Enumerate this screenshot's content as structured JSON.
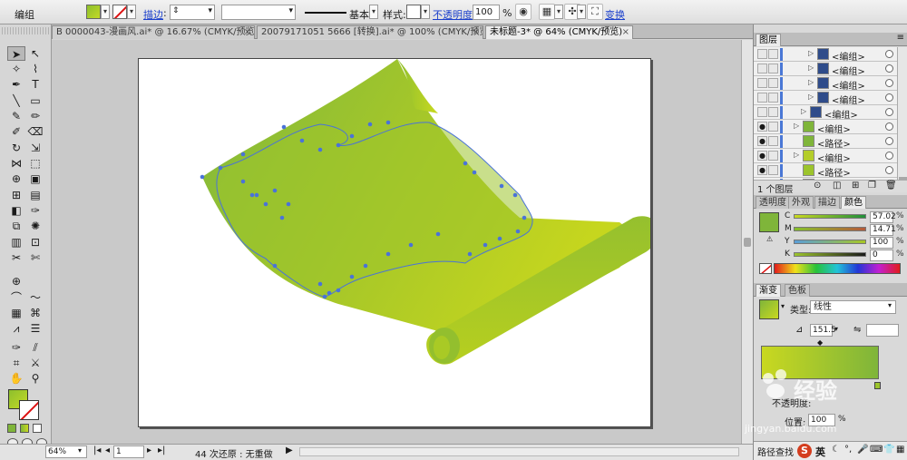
{
  "control_bar": {
    "selection_label": "编组",
    "stroke_link": "描边",
    "stroke_profile_label": "基本",
    "style_label": "样式:",
    "opacity_link": "不透明度:",
    "opacity_value": "100",
    "opacity_unit": "%",
    "transform_link": "变换"
  },
  "tabs": [
    {
      "label": "B 0000043-漫画风.ai* @ 16.67% (CMYK/预览)",
      "active": false
    },
    {
      "label": "20079171051 5666 [转换].ai* @ 100% (CMYK/预览)",
      "active": false
    },
    {
      "label": "未标题-3* @ 64% (CMYK/预览)",
      "active": true
    }
  ],
  "tab_close_glyph": "×",
  "status_bar": {
    "zoom": "64%",
    "artboard_number": "1",
    "history_text": "44 次还原 : 无重做"
  },
  "layers_panel": {
    "title": "图层",
    "rows": [
      {
        "name": "<编组>",
        "indent": 3
      },
      {
        "name": "<编组>",
        "indent": 3
      },
      {
        "name": "<编组>",
        "indent": 3
      },
      {
        "name": "<编组>",
        "indent": 3
      },
      {
        "name": "<编组>",
        "indent": 2
      },
      {
        "name": "<编组>",
        "indent": 1
      },
      {
        "name": "<路径>",
        "indent": 1
      },
      {
        "name": "<编组>",
        "indent": 1
      },
      {
        "name": "<路径>",
        "indent": 1
      },
      {
        "name": "<路径>",
        "indent": 1
      }
    ],
    "footer_count": "1 个图层"
  },
  "color_panel": {
    "tabs": [
      "透明度",
      "外观",
      "描边",
      "颜色"
    ],
    "active_tab": "颜色",
    "channels": [
      {
        "label": "C",
        "value": "57.02",
        "unit": "%"
      },
      {
        "label": "M",
        "value": "14.71",
        "unit": "%"
      },
      {
        "label": "Y",
        "value": "100",
        "unit": "%"
      },
      {
        "label": "K",
        "value": "0",
        "unit": "%"
      }
    ],
    "fill_color": "#7fb53a"
  },
  "gradient_panel": {
    "tabs": [
      "渐变",
      "色板"
    ],
    "active_tab": "渐变",
    "type_label": "类型:",
    "type_value": "线性",
    "angle_value": "151.5",
    "opacity_label": "不透明度:",
    "location_label": "位置:",
    "location_value": "100",
    "location_unit": "%",
    "gradient_start": "#7fb53a",
    "gradient_end": "#c9d820"
  },
  "bottom_panel": {
    "label": "路径查找"
  },
  "tray": {
    "ime_label": "英"
  },
  "watermark": {
    "brand": "经验",
    "url": "jingyan.baidu.com"
  },
  "artwork": {
    "scroll_color_light": "#c6d61e",
    "scroll_color_dark": "#7fb53a",
    "anchor_color": "#4a73d8"
  }
}
